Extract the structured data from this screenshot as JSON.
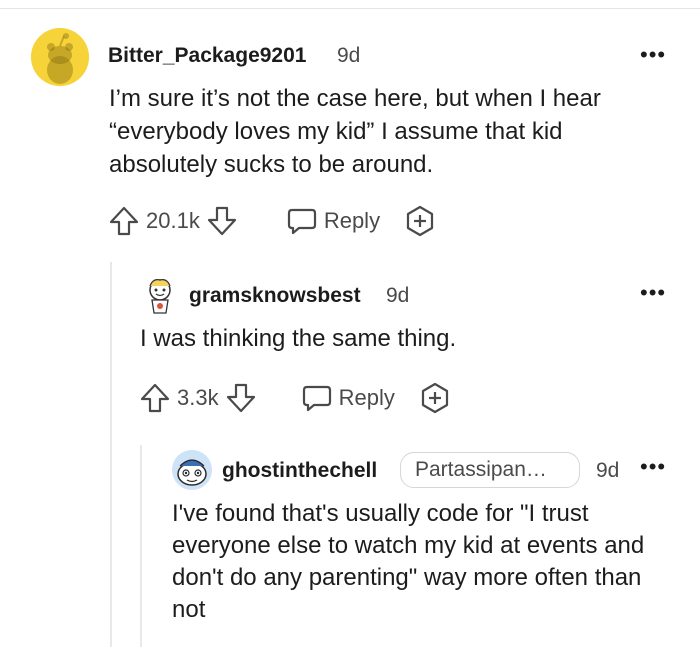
{
  "comments": [
    {
      "username": "Bitter_Package9201",
      "time": "9d",
      "text": "I’m sure it’s not the case here, but when I hear “everybody loves my kid” I assume that kid absolutely sucks to be around.",
      "votes": "20.1k",
      "reply_label": "Reply",
      "more": "•••",
      "avatar_icon": "snoo-yellow-avatar"
    },
    {
      "username": "gramsknowsbest",
      "time": "9d",
      "text": "I was thinking the same thing.",
      "votes": "3.3k",
      "reply_label": "Reply",
      "more": "•••",
      "avatar_icon": "cartoon-avatar"
    },
    {
      "username": "ghostinthechell",
      "flair": "Partassipan…",
      "time": "9d",
      "text": "I've found that's usually code for \"I trust everyone else to watch my kid at events and don't do any parenting\" way more often than not",
      "more": "•••",
      "avatar_icon": "snoo-blue-avatar"
    }
  ],
  "colors": {
    "text": "#1c1c1c",
    "meta": "#4a4a4a",
    "avatar_yellow": "#f7d33a",
    "thread_line": "#e8e8e8"
  }
}
